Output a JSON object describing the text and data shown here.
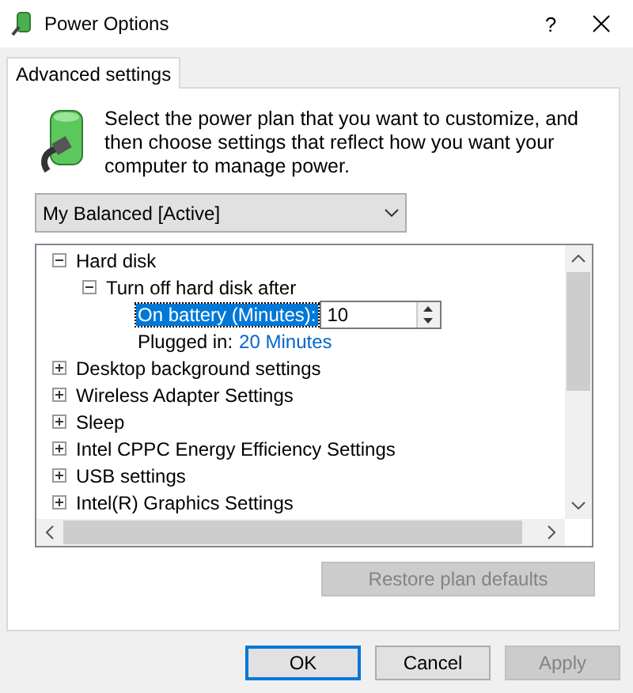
{
  "window": {
    "title": "Power Options",
    "help": "?"
  },
  "tabs": [
    {
      "label": "Advanced settings",
      "selected": true
    }
  ],
  "intro": "Select the power plan that you want to customize, and then choose settings that reflect how you want your computer to manage power.",
  "plan_dropdown": {
    "value": "My Balanced [Active]"
  },
  "tree": [
    {
      "label": "Hard disk",
      "expanded": true,
      "children": [
        {
          "label": "Turn off hard disk after",
          "expanded": true,
          "settings": [
            {
              "kind": "spinner",
              "label": "On battery (Minutes):",
              "value": "10",
              "selected": true
            },
            {
              "kind": "link",
              "label": "Plugged in:",
              "value": "20 Minutes",
              "selected": false
            }
          ]
        }
      ]
    },
    {
      "label": "Desktop background settings",
      "expanded": false
    },
    {
      "label": "Wireless Adapter Settings",
      "expanded": false
    },
    {
      "label": "Sleep",
      "expanded": false
    },
    {
      "label": "Intel CPPC Energy Efficiency Settings",
      "expanded": false
    },
    {
      "label": "USB settings",
      "expanded": false
    },
    {
      "label": "Intel(R) Graphics Settings",
      "expanded": false
    }
  ],
  "restore_button": {
    "label": "Restore plan defaults",
    "disabled": true
  },
  "buttons": [
    {
      "label": "OK",
      "default": true,
      "disabled": false
    },
    {
      "label": "Cancel",
      "default": false,
      "disabled": false
    },
    {
      "label": "Apply",
      "default": false,
      "disabled": true
    }
  ]
}
